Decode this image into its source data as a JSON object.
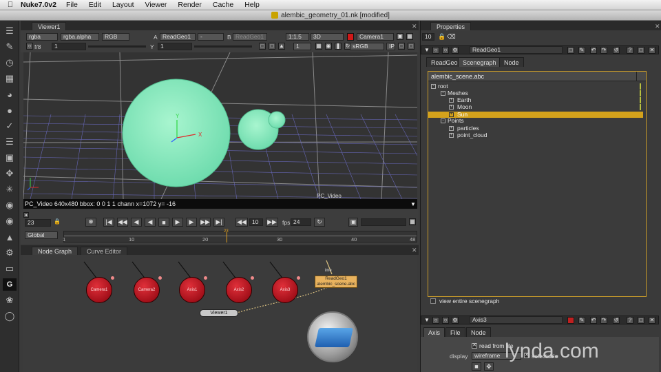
{
  "menubar": {
    "app": "Nuke7.0v2",
    "items": [
      "File",
      "Edit",
      "Layout",
      "Viewer",
      "Render",
      "Cache",
      "Help"
    ]
  },
  "window": {
    "title": "alembic_geometry_01.nk [modified]"
  },
  "viewer": {
    "tab": "Viewer1",
    "row1": {
      "channels": "rgba",
      "alpha": "rgba.alpha",
      "rgb": "RGB",
      "a_label": "A",
      "a_input": "ReadGeo1",
      "a_op": "-",
      "b_label": "B",
      "b_input": "ReadGeo1",
      "zoom": "1:1.5",
      "mode": "3D",
      "camera": "Camera1"
    },
    "row2": {
      "fstop": "f/8",
      "gain": "1",
      "gamma_label": "Y",
      "gamma": "1",
      "frame_step": "1",
      "lut": "sRGB",
      "ip": "IP"
    },
    "axis_labels": {
      "x": "X",
      "y": "Y"
    },
    "format_label": "PC_Video",
    "infobar": "PC_Video 640x480 bbox: 0 0 1 1 chann  x=1072 y= -16",
    "timeline": {
      "frame": "23",
      "step": "10",
      "fps_label": "fps",
      "fps": "24",
      "range": "Global",
      "ticks": [
        "1",
        "10",
        "20",
        "30",
        "40",
        "48"
      ],
      "marker": "23"
    }
  },
  "nodegraph": {
    "tabs": [
      "Node Graph",
      "Curve Editor"
    ],
    "nodes": [
      "Camera1",
      "Camera2",
      "Axis1",
      "Axis2",
      "Axis3"
    ],
    "readgeo": {
      "name": "ReadGeo1",
      "file": "alembic_scene.abc",
      "tag": "ime"
    },
    "viewer_node": "Viewer1"
  },
  "properties": {
    "title": "Properties",
    "max_panels": "10",
    "panel1": {
      "name": "ReadGeo1",
      "tabs": [
        "ReadGeo",
        "Scenegraph",
        "Node"
      ],
      "scene_file": "alembic_scene.abc",
      "tree": [
        {
          "label": "root",
          "level": 0,
          "sign": "-"
        },
        {
          "label": "Meshes",
          "level": 1,
          "sign": "-"
        },
        {
          "label": "Earth",
          "level": 2,
          "sign": "+"
        },
        {
          "label": "Moon",
          "level": 2,
          "sign": "+"
        },
        {
          "label": "Sun",
          "level": 2,
          "sign": "+",
          "selected": true
        },
        {
          "label": "Points",
          "level": 1,
          "sign": "-"
        },
        {
          "label": "particles",
          "level": 2,
          "sign": "+"
        },
        {
          "label": "point_cloud",
          "level": 2,
          "sign": "+"
        }
      ],
      "view_entire": "view entire scenegraph"
    },
    "panel2": {
      "name": "Axis3",
      "tabs": [
        "Axis",
        "File",
        "Node"
      ],
      "read_from_file": "read from file",
      "display_label": "display",
      "display_value": "wireframe",
      "selectable": "selectable"
    }
  },
  "watermark": "lynda.com",
  "colors": {
    "sphere": "#7fe8b8",
    "selection": "#d4a21c",
    "node_red": "#c0141e",
    "frame_orange": "#c79a2a"
  }
}
